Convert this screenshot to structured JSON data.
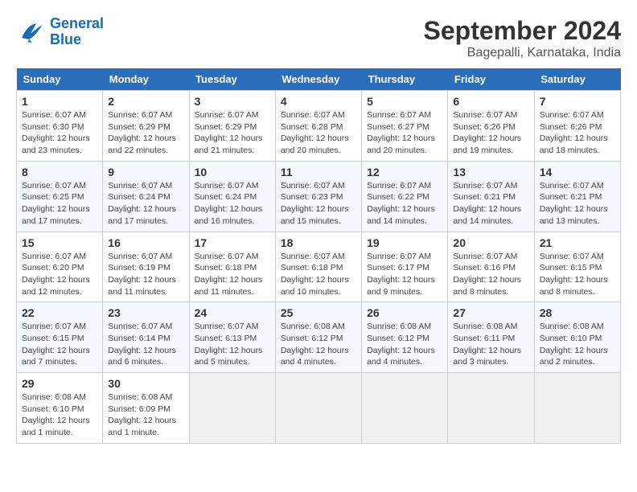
{
  "logo": {
    "line1": "General",
    "line2": "Blue"
  },
  "title": "September 2024",
  "subtitle": "Bagepalli, Karnataka, India",
  "days_of_week": [
    "Sunday",
    "Monday",
    "Tuesday",
    "Wednesday",
    "Thursday",
    "Friday",
    "Saturday"
  ],
  "weeks": [
    [
      {
        "num": "1",
        "sunrise": "6:07 AM",
        "sunset": "6:30 PM",
        "daylight": "12 hours and 23 minutes."
      },
      {
        "num": "2",
        "sunrise": "6:07 AM",
        "sunset": "6:29 PM",
        "daylight": "12 hours and 22 minutes."
      },
      {
        "num": "3",
        "sunrise": "6:07 AM",
        "sunset": "6:29 PM",
        "daylight": "12 hours and 21 minutes."
      },
      {
        "num": "4",
        "sunrise": "6:07 AM",
        "sunset": "6:28 PM",
        "daylight": "12 hours and 20 minutes."
      },
      {
        "num": "5",
        "sunrise": "6:07 AM",
        "sunset": "6:27 PM",
        "daylight": "12 hours and 20 minutes."
      },
      {
        "num": "6",
        "sunrise": "6:07 AM",
        "sunset": "6:26 PM",
        "daylight": "12 hours and 19 minutes."
      },
      {
        "num": "7",
        "sunrise": "6:07 AM",
        "sunset": "6:26 PM",
        "daylight": "12 hours and 18 minutes."
      }
    ],
    [
      {
        "num": "8",
        "sunrise": "6:07 AM",
        "sunset": "6:25 PM",
        "daylight": "12 hours and 17 minutes."
      },
      {
        "num": "9",
        "sunrise": "6:07 AM",
        "sunset": "6:24 PM",
        "daylight": "12 hours and 17 minutes."
      },
      {
        "num": "10",
        "sunrise": "6:07 AM",
        "sunset": "6:24 PM",
        "daylight": "12 hours and 16 minutes."
      },
      {
        "num": "11",
        "sunrise": "6:07 AM",
        "sunset": "6:23 PM",
        "daylight": "12 hours and 15 minutes."
      },
      {
        "num": "12",
        "sunrise": "6:07 AM",
        "sunset": "6:22 PM",
        "daylight": "12 hours and 14 minutes."
      },
      {
        "num": "13",
        "sunrise": "6:07 AM",
        "sunset": "6:21 PM",
        "daylight": "12 hours and 14 minutes."
      },
      {
        "num": "14",
        "sunrise": "6:07 AM",
        "sunset": "6:21 PM",
        "daylight": "12 hours and 13 minutes."
      }
    ],
    [
      {
        "num": "15",
        "sunrise": "6:07 AM",
        "sunset": "6:20 PM",
        "daylight": "12 hours and 12 minutes."
      },
      {
        "num": "16",
        "sunrise": "6:07 AM",
        "sunset": "6:19 PM",
        "daylight": "12 hours and 11 minutes."
      },
      {
        "num": "17",
        "sunrise": "6:07 AM",
        "sunset": "6:18 PM",
        "daylight": "12 hours and 11 minutes."
      },
      {
        "num": "18",
        "sunrise": "6:07 AM",
        "sunset": "6:18 PM",
        "daylight": "12 hours and 10 minutes."
      },
      {
        "num": "19",
        "sunrise": "6:07 AM",
        "sunset": "6:17 PM",
        "daylight": "12 hours and 9 minutes."
      },
      {
        "num": "20",
        "sunrise": "6:07 AM",
        "sunset": "6:16 PM",
        "daylight": "12 hours and 8 minutes."
      },
      {
        "num": "21",
        "sunrise": "6:07 AM",
        "sunset": "6:15 PM",
        "daylight": "12 hours and 8 minutes."
      }
    ],
    [
      {
        "num": "22",
        "sunrise": "6:07 AM",
        "sunset": "6:15 PM",
        "daylight": "12 hours and 7 minutes."
      },
      {
        "num": "23",
        "sunrise": "6:07 AM",
        "sunset": "6:14 PM",
        "daylight": "12 hours and 6 minutes."
      },
      {
        "num": "24",
        "sunrise": "6:07 AM",
        "sunset": "6:13 PM",
        "daylight": "12 hours and 5 minutes."
      },
      {
        "num": "25",
        "sunrise": "6:08 AM",
        "sunset": "6:12 PM",
        "daylight": "12 hours and 4 minutes."
      },
      {
        "num": "26",
        "sunrise": "6:08 AM",
        "sunset": "6:12 PM",
        "daylight": "12 hours and 4 minutes."
      },
      {
        "num": "27",
        "sunrise": "6:08 AM",
        "sunset": "6:11 PM",
        "daylight": "12 hours and 3 minutes."
      },
      {
        "num": "28",
        "sunrise": "6:08 AM",
        "sunset": "6:10 PM",
        "daylight": "12 hours and 2 minutes."
      }
    ],
    [
      {
        "num": "29",
        "sunrise": "6:08 AM",
        "sunset": "6:10 PM",
        "daylight": "12 hours and 1 minute."
      },
      {
        "num": "30",
        "sunrise": "6:08 AM",
        "sunset": "6:09 PM",
        "daylight": "12 hours and 1 minute."
      },
      null,
      null,
      null,
      null,
      null
    ]
  ]
}
